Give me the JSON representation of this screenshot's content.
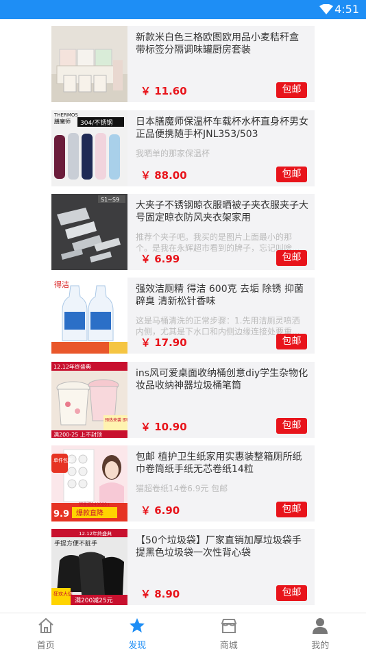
{
  "status_bar": {
    "time": "4:51",
    "wifi_icon": "wifi-icon"
  },
  "products": [
    {
      "title": "新款米白色三格欧图欧用品小麦秸秆盒 带标签分隔调味罐厨房套装",
      "desc": "",
      "price": "￥ 11.60",
      "badge": "包邮",
      "thumb": "seasoning-box"
    },
    {
      "title": "日本膳魔师保温杯车载杯水杯直身杯男女正品便携随手杯JNL353/503",
      "desc": "我晒单的那家保温杯",
      "price": "￥ 88.00",
      "badge": "包邮",
      "thumb": "thermos"
    },
    {
      "title": "大夹子不锈钢晾衣服晒被子夹衣服夹子大号固定晾衣防风夹衣架家用",
      "desc": "推荐个夹子吧。我买的是图片上面最小的那个。是我在永辉超市看到的牌子，忘记叫啥...",
      "price": "￥ 6.99",
      "badge": "包邮",
      "thumb": "clips"
    },
    {
      "title": "强效洁厕精 得洁 600克 去垢 除锈 抑菌 辟臭 清新松针香味",
      "desc": "这是马桶清洗的正常步骤：1.先用洁厕灵喷洒内侧，尤其是下水口和内侧边缘连接处要重...",
      "price": "￥ 17.90",
      "badge": "包邮",
      "thumb": "cleaner"
    },
    {
      "title": "ins风可爱桌面收纳桶创意diy学生杂物化妆品收纳神器垃圾桶笔筒",
      "desc": "",
      "price": "￥ 10.90",
      "badge": "包邮",
      "thumb": "bins"
    },
    {
      "title": "包邮 植护卫生纸家用实惠装整箱厕所纸巾卷筒纸手纸无芯卷纸14粒",
      "desc": "猫超卷纸14卷6.9元 包邮",
      "price": "￥ 6.90",
      "badge": "包邮",
      "thumb": "tissue"
    },
    {
      "title": "【50个垃圾袋】厂家直销加厚垃圾袋手提黑色垃圾袋一次性背心袋",
      "desc": "",
      "price": "￥ 8.90",
      "badge": "包邮",
      "thumb": "trashbags"
    }
  ],
  "thumb_text": {
    "t1_brand": "THERMOS",
    "t1_cn": "膳魔师",
    "t1_tag": "304/不锈钢",
    "t2_tag": "S1~S9",
    "t3_brand": "得洁",
    "t4_top": "12.12年终盛典",
    "t4_b1": "满200-25 上不封顶",
    "t4_b2": "预热来袭 即时优惠",
    "t5_tag1": "单件包邮",
    "t5_price": "9.9",
    "t5_sale": "爆款直降",
    "t5_sold": "销量破840000+",
    "t6_top": "12.12年终盛典",
    "t6_h": "手提方便不脏手",
    "t6_b1": "狂欢大促",
    "t6_b2": "满200减25元"
  },
  "tabs": [
    {
      "label": "首页",
      "icon": "home-icon",
      "active": false
    },
    {
      "label": "发现",
      "icon": "star-icon",
      "active": true
    },
    {
      "label": "商城",
      "icon": "store-icon",
      "active": false
    },
    {
      "label": "我的",
      "icon": "user-icon",
      "active": false
    }
  ],
  "colors": {
    "accent": "#1e8ef5",
    "price": "#e8141b",
    "card_bg": "#f3f3f5"
  }
}
